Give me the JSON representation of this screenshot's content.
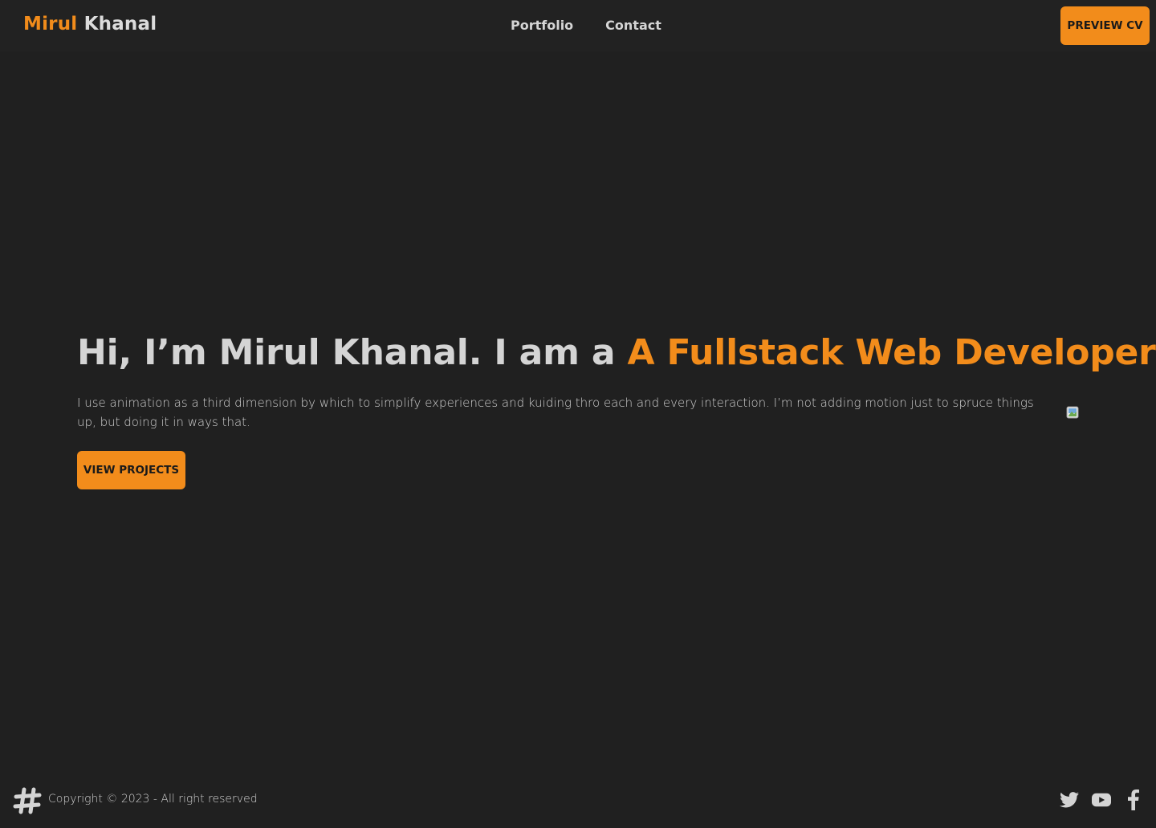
{
  "header": {
    "brand_first": "Mirul",
    "brand_last": "Khanal",
    "nav": [
      {
        "label": "Portfolio"
      },
      {
        "label": "Contact"
      }
    ],
    "cv_button": "PREVIEW CV"
  },
  "hero": {
    "title_prefix": "Hi, I’m Mirul Khanal. I am a",
    "title_accent": "A Fullstack Web Developer",
    "description": "I use animation as a third dimension by which to simplify experiences and kuiding thro each and every interaction. I’m not adding motion just to spruce things up, but doing it in ways that.",
    "button": "VIEW PROJECTS"
  },
  "footer": {
    "copyright": "Copyright © 2023 - All right reserved",
    "logo_icon": "hashtag-icon",
    "social": [
      "twitter-icon",
      "youtube-icon",
      "facebook-icon"
    ]
  },
  "colors": {
    "background": "#202020",
    "header": "#222222",
    "accent": "#f28c1b",
    "text": "#d4d4d4"
  }
}
